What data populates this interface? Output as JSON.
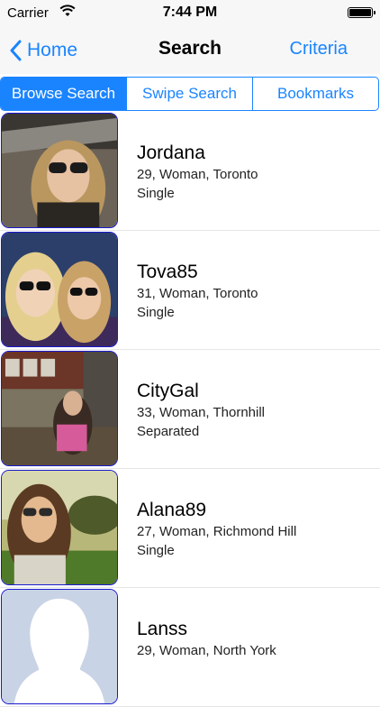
{
  "status_bar": {
    "carrier": "Carrier",
    "time": "7:44 PM"
  },
  "nav": {
    "back_label": "Home",
    "title": "Search",
    "right_label": "Criteria"
  },
  "tabs": [
    {
      "label": "Browse Search",
      "active": true
    },
    {
      "label": "Swipe Search",
      "active": false
    },
    {
      "label": "Bookmarks",
      "active": false
    }
  ],
  "profiles": [
    {
      "name": "Jordana",
      "details": "29, Woman, Toronto",
      "status": "Single",
      "photo": "woman-sunglasses-selfie"
    },
    {
      "name": "Tova85",
      "details": "31, Woman, Toronto",
      "status": "Single",
      "photo": "two-women-sunglasses"
    },
    {
      "name": "CityGal",
      "details": "33, Woman, Thornhill",
      "status": "Separated",
      "photo": "woman-patio"
    },
    {
      "name": "Alana89",
      "details": "27, Woman, Richmond Hill",
      "status": "Single",
      "photo": "woman-outdoors"
    },
    {
      "name": "Lanss",
      "details": "29, Woman, North York",
      "status": "",
      "photo": "default-silhouette"
    }
  ],
  "colors": {
    "accent": "#1a84ff",
    "photo_border": "#1a1acc"
  }
}
